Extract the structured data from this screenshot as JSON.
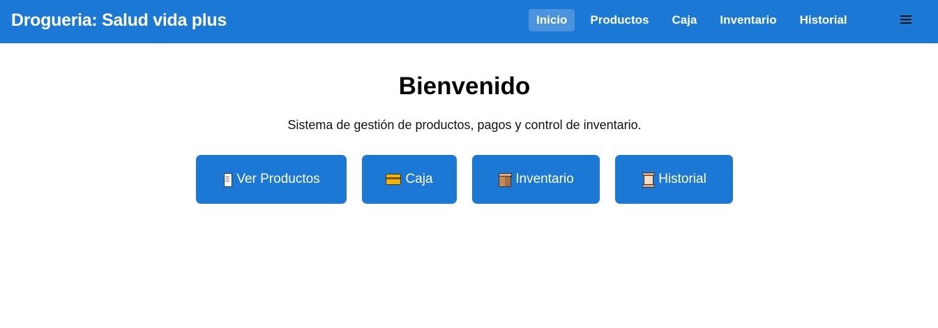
{
  "app": {
    "brand": "Drogueria: Salud vida plus"
  },
  "nav": {
    "items": [
      {
        "label": "Inicio",
        "active": true
      },
      {
        "label": "Productos",
        "active": false
      },
      {
        "label": "Caja",
        "active": false
      },
      {
        "label": "Inventario",
        "active": false
      },
      {
        "label": "Historial",
        "active": false
      }
    ],
    "menu_icon": "hamburger-menu-icon"
  },
  "main": {
    "title": "Bienvenido",
    "subtitle": "Sistema de gestión de productos, pagos y control de inventario.",
    "actions": [
      {
        "label": "Ver Productos",
        "icon": "scroll-page-icon"
      },
      {
        "label": "Caja",
        "icon": "credit-card-icon"
      },
      {
        "label": "Inventario",
        "icon": "package-box-icon"
      },
      {
        "label": "Historial",
        "icon": "parchment-scroll-icon"
      }
    ]
  },
  "colors": {
    "primary": "#1c78d5",
    "active_nav": "#4c93dd",
    "text": "#111111",
    "background": "#ffffff"
  }
}
